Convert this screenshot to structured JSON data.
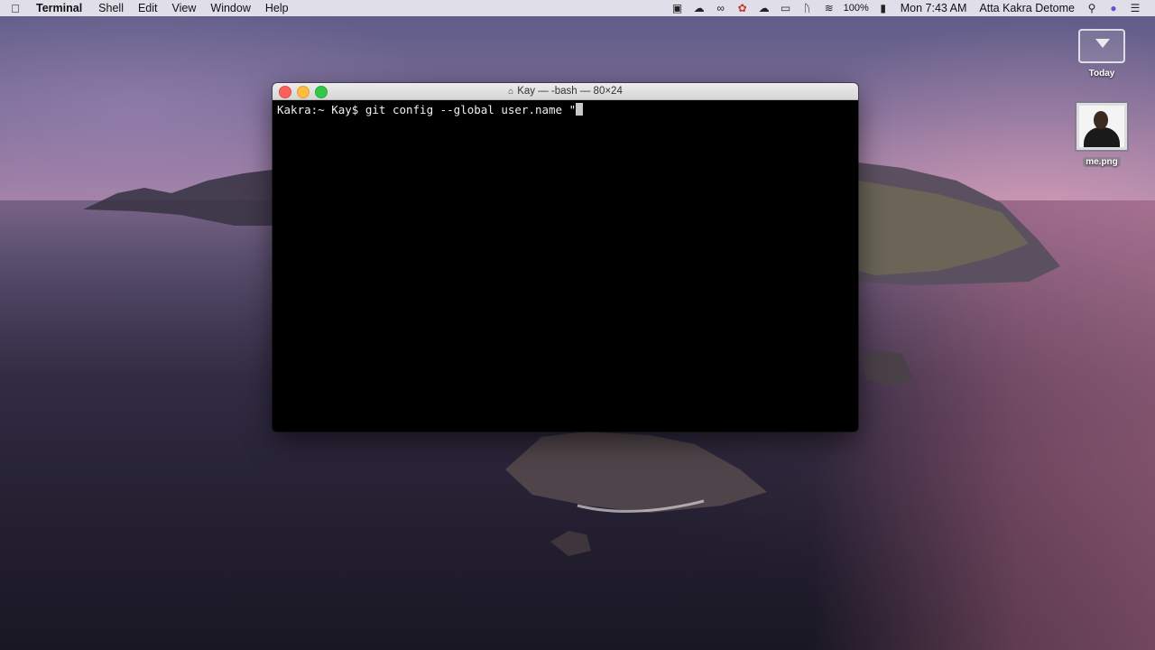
{
  "menubar": {
    "apple_icon": "",
    "app_name": "Terminal",
    "menus": [
      "Shell",
      "Edit",
      "View",
      "Window",
      "Help"
    ],
    "status_icons": [
      "screen-record-icon",
      "cloud-upload-icon",
      "creative-cloud-icon",
      "notification-badge-icon",
      "cloud-icon",
      "airplay-icon",
      "bluetooth-icon",
      "wifi-icon"
    ],
    "battery": "100%",
    "clock": "Mon 7:43 AM",
    "user": "Atta Kakra Detome"
  },
  "desktop": {
    "icons": [
      {
        "label": "Today",
        "type": "folder"
      },
      {
        "label": "me.png",
        "type": "image"
      }
    ]
  },
  "terminal": {
    "title": "Kay — -bash — 80×24",
    "prompt": "Kakra:~ Kay$ ",
    "command": "git config --global user.name \""
  }
}
